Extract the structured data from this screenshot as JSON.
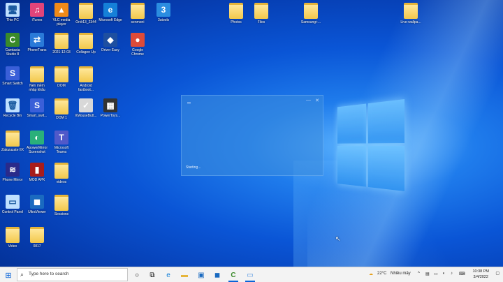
{
  "desktop_icons": [
    {
      "label": "This PC",
      "glyph": "🖥",
      "kind": "sys"
    },
    {
      "label": "iTunes",
      "glyph": "♫",
      "kind": "app",
      "color": "#e2447a"
    },
    {
      "label": "VLC media player",
      "glyph": "▲",
      "kind": "app",
      "color": "#f08a18"
    },
    {
      "label": "Ordr13_2344",
      "glyph": "",
      "kind": "folder"
    },
    {
      "label": "Microsoft Edge",
      "glyph": "e",
      "kind": "app",
      "color": "#1580d8"
    },
    {
      "label": "senmoni",
      "glyph": "",
      "kind": "folder"
    },
    {
      "label": "3utools",
      "glyph": "3",
      "kind": "app",
      "color": "#2b8de0"
    },
    {
      "label": "Photos",
      "glyph": "",
      "kind": "folder"
    },
    {
      "label": "Files",
      "glyph": "",
      "kind": "folder"
    },
    {
      "label": "Samsung+...",
      "glyph": "",
      "kind": "folder"
    },
    {
      "label": "Live-wallpa...",
      "glyph": "",
      "kind": "folder"
    },
    {
      "label": "Camtasia Studio 8",
      "glyph": "C",
      "kind": "app",
      "color": "#3a8a2a"
    },
    {
      "label": "PhoneTrans",
      "glyph": "⇄",
      "kind": "app",
      "color": "#2a7ad8"
    },
    {
      "label": "2021-12-03",
      "glyph": "",
      "kind": "folder"
    },
    {
      "label": "Collagen Up",
      "glyph": "",
      "kind": "folder"
    },
    {
      "label": "Driver Easy",
      "glyph": "◆",
      "kind": "app",
      "color": "#1e4fa0"
    },
    {
      "label": "Google Chrome",
      "glyph": "●",
      "kind": "app",
      "color": "#dd4b39"
    },
    {
      "label": "Smart Switch",
      "glyph": "S",
      "kind": "app",
      "color": "#3a5fd8"
    },
    {
      "label": "Nén mềm nhập khẩu",
      "glyph": "",
      "kind": "folder"
    },
    {
      "label": "DOM",
      "glyph": "",
      "kind": "folder"
    },
    {
      "label": "Android fastboot...",
      "glyph": "",
      "kind": "folder"
    },
    {
      "label": "Recycle Bin",
      "glyph": "🗑",
      "kind": "sys"
    },
    {
      "label": "Smart_swit...",
      "glyph": "S",
      "kind": "app",
      "color": "#3a5fd8"
    },
    {
      "label": "DOM 1",
      "glyph": "",
      "kind": "folder"
    },
    {
      "label": "XMouseButt...",
      "glyph": "✓",
      "kind": "app",
      "color": "#d8d8d8"
    },
    {
      "label": "PowerToys...",
      "glyph": "▦",
      "kind": "app",
      "color": "#333"
    },
    {
      "label": "Zalozuzate IIX",
      "glyph": "",
      "kind": "folder"
    },
    {
      "label": "ApowerMirror Sceenshot",
      "glyph": "◐",
      "kind": "app",
      "color": "#2ab07a"
    },
    {
      "label": "Microsoft Teams",
      "glyph": "T",
      "kind": "app",
      "color": "#5059c9"
    },
    {
      "label": "Phone Mirror",
      "glyph": "≋",
      "kind": "app",
      "color": "#2a2a8a"
    },
    {
      "label": "MOD APK",
      "glyph": "▮",
      "kind": "app",
      "color": "#a81c1c"
    },
    {
      "label": "videos",
      "glyph": "",
      "kind": "folder"
    },
    {
      "label": "Control Panel",
      "glyph": "▭",
      "kind": "sys"
    },
    {
      "label": "UltraViewer",
      "glyph": "◼",
      "kind": "app",
      "color": "#1a6ac0"
    },
    {
      "label": "Sessions",
      "glyph": "",
      "kind": "folder"
    },
    {
      "label": "Video",
      "glyph": "",
      "kind": "folder"
    },
    {
      "label": "0817",
      "glyph": "",
      "kind": "folder"
    }
  ],
  "dialog": {
    "status": "Starting..."
  },
  "taskbar": {
    "search_placeholder": "Type here to search",
    "weather": "22°C",
    "weather_desc": "Nhiều mây",
    "time": "10:38 PM",
    "date": "3/4/2022"
  },
  "colors": {
    "taskbar_bg": "#f3f3f3",
    "accent": "#0a64d8"
  }
}
